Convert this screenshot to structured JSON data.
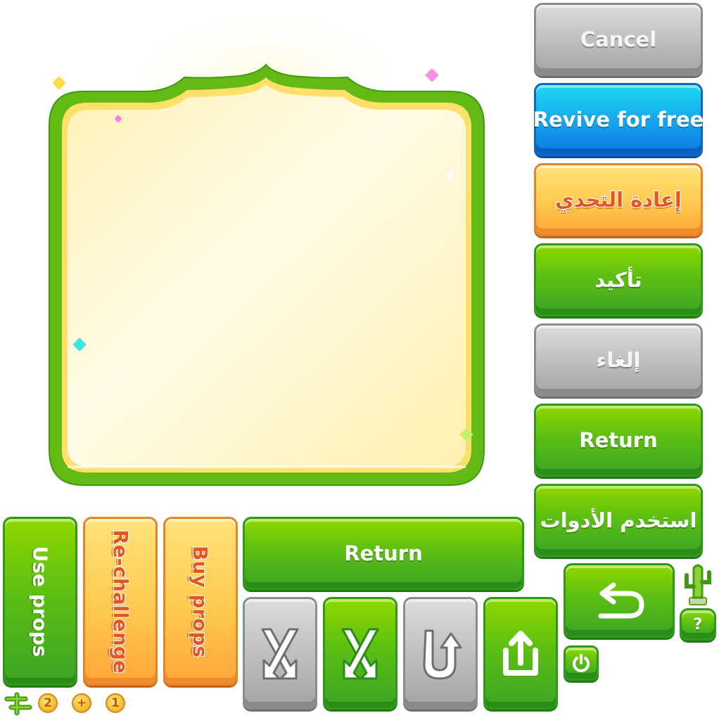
{
  "colors": {
    "panel_frame": "#5cb812",
    "panel_fill": "#fff6c6",
    "green": "#5dbf12",
    "gray": "#bdbdbd",
    "blue": "#15a9ee",
    "orange": "#ffc94f"
  },
  "right_column": {
    "cancel_label": "Cancel",
    "revive_label": "Revive for free",
    "rechallenge_ar_label": "إعادة التحدي",
    "confirm_ar_label": "تأكيد",
    "cancel_ar_label": "إلغاء",
    "return_label": "Return",
    "use_tools_ar_label": "استخدم الأدوات"
  },
  "vertical_buttons": {
    "use_props_label": "Use props",
    "rechallenge_label": "Re-challenge",
    "buy_props_label": "Buy props"
  },
  "wide_return_label": "Return",
  "icon_buttons": [
    "swap-arrows-icon",
    "swap-arrows-icon",
    "u-turn-icon",
    "share-icon",
    "undo-icon",
    "power-icon",
    "help-icon"
  ],
  "small_counters": {
    "coin_1": "2",
    "coin_2": "+",
    "coin_3": "1",
    "help_symbol": "?"
  }
}
